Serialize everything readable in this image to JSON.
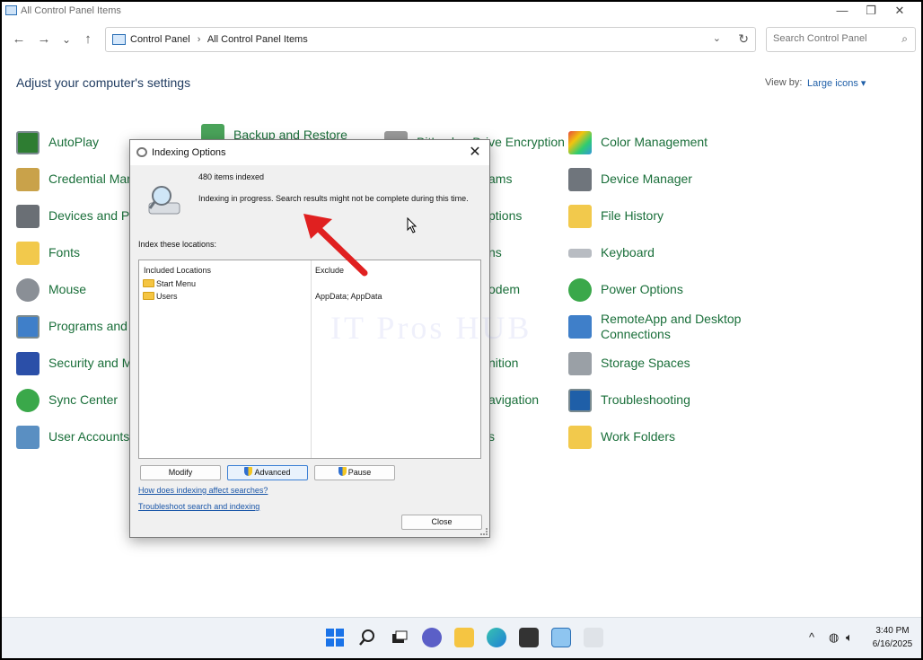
{
  "window": {
    "title": "All Control Panel Items",
    "minimize": "—",
    "restore": "❐",
    "close": "✕"
  },
  "nav": {
    "back": "←",
    "forward": "→",
    "recent": "⌄",
    "up": "↑"
  },
  "address": {
    "crumbs": [
      "Control Panel",
      "All Control Panel Items"
    ],
    "separator": "›",
    "dropdown": "⌄",
    "refresh": "↻"
  },
  "search": {
    "placeholder": "Search Control Panel",
    "icon": "⌕"
  },
  "header": {
    "title": "Adjust your computer's settings",
    "view_by_label": "View by:",
    "view_by_value": "Large icons ▾"
  },
  "items": {
    "col1": [
      "AutoPlay",
      "Credential Mana",
      "Devices and Prir",
      "Fonts",
      "Mouse",
      "Programs and F",
      "Security and Ma",
      "Sync Center",
      "User Accounts"
    ],
    "col2_top": "Backup and Restore",
    "col3_top": "BitLocker Drive Encryption",
    "col3_partial": [
      "ams",
      "ptions",
      "ns",
      "odem",
      "nition",
      "avigation",
      "s"
    ],
    "col4": [
      "Color Management",
      "Device Manager",
      "File History",
      "Keyboard",
      "Power Options",
      "RemoteApp and Desktop",
      "Connections",
      "Storage Spaces",
      "Troubleshooting",
      "Work Folders"
    ]
  },
  "dialog": {
    "title": "Indexing Options",
    "close": "✕",
    "count": "480 items indexed",
    "status": "Indexing in progress. Search results might not be complete during this time.",
    "locations_label": "Index these locations:",
    "columns": [
      "Included Locations",
      "Exclude"
    ],
    "rows": [
      {
        "location": "Start Menu",
        "exclude": ""
      },
      {
        "location": "Users",
        "exclude": "AppData; AppData"
      }
    ],
    "buttons": {
      "modify": "Modify",
      "advanced": "Advanced",
      "pause": "Pause",
      "close": "Close"
    },
    "links": [
      "How does indexing affect searches?",
      "Troubleshoot search and indexing"
    ]
  },
  "watermark": "IT Pros HUB",
  "taskbar": {
    "time": "3:40 PM",
    "date": "6/16/2025",
    "tray_chevron": "^"
  },
  "colors": {
    "link_green": "#1a6f3a",
    "accent_blue": "#1f5fa8",
    "arrow_red": "#e02020"
  }
}
